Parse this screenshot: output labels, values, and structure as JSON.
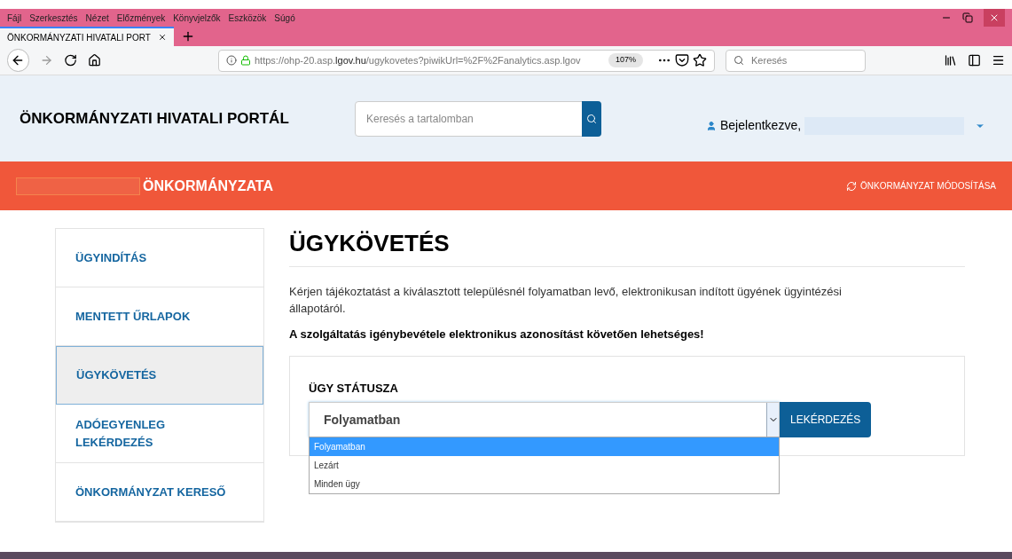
{
  "menu_bar": [
    "Fájl",
    "Szerkesztés",
    "Nézet",
    "Előzmények",
    "Könyvjelzők",
    "Eszközök",
    "Súgó"
  ],
  "tabs": [
    {
      "label": "ÖNKORMÁNYZATI HIVATALI PORT",
      "selected": true
    }
  ],
  "toolbar": {
    "url_prefix": "https://ohp-20.asp.",
    "url_domain": "lgov.hu",
    "url_rest": "/ugykovetes?piwikUrl=%2F%2Fanalytics.asp.lgov",
    "zoom": "107%",
    "search_placeholder": "Keresés"
  },
  "header": {
    "title": "ÖNKORMÁNYZATI HIVATALI PORTÁL",
    "search_placeholder": "Keresés a tartalomban",
    "login_label": "Bejelentkezve,"
  },
  "banner": {
    "title": "ÖNKORMÁNYZATA",
    "action": "ÖNKORMÁNYZAT MÓDOSÍTÁSA"
  },
  "sidebar": {
    "items": [
      {
        "label": "ÜGYINDÍTÁS",
        "selected": false
      },
      {
        "label": "MENTETT ŰRLAPOK",
        "selected": false
      },
      {
        "label": "ÜGYKÖVETÉS",
        "selected": true
      },
      {
        "label": "ADÓEGYENLEG LEKÉRDEZÉS",
        "selected": false
      },
      {
        "label": "ÖNKORMÁNYZAT KERESŐ",
        "selected": false
      }
    ]
  },
  "main": {
    "heading": "ÜGYKÖVETÉS",
    "intro": "Kérjen tájékoztatást a kiválasztott településnél folyamatban levő, elektronikusan indított ügyének ügyintézési állapotáról.",
    "notice": "A szolgáltatás igénybevétele elektronikus azonosítást követően lehetséges!",
    "form": {
      "label": "ÜGY STÁTUSZA",
      "value": "Folyamatban",
      "button": "LEKÉRDEZÉS",
      "options": [
        {
          "label": "Folyamatban",
          "selected": true
        },
        {
          "label": "Lezárt",
          "selected": false
        },
        {
          "label": "Minden ügy",
          "selected": false
        }
      ]
    }
  }
}
